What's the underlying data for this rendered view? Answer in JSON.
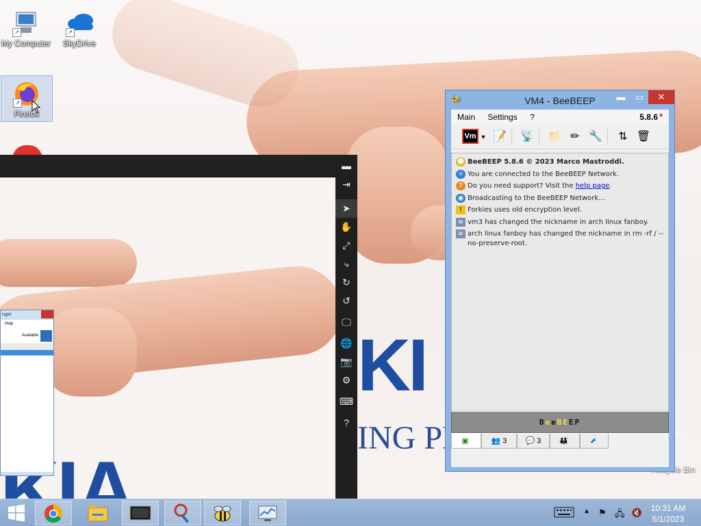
{
  "desktop": {
    "icons": [
      {
        "label": "My Computer",
        "icon": "computer-icon"
      },
      {
        "label": "SkyDrive",
        "icon": "cloud-icon"
      },
      {
        "label": "Firefox",
        "icon": "firefox-icon"
      }
    ],
    "recycle_bin": "Recycle Bin",
    "wallpaper": {
      "brand_letters": "KI",
      "brand_letters_bottom": "KIA",
      "tagline": "ING PE"
    }
  },
  "viewer": {
    "tools": [
      "minimize-icon",
      "pin-icon",
      "pointer-icon",
      "hand-icon",
      "fullscreen-icon",
      "connect-icon",
      "rotate-right-icon",
      "rotate-left-icon",
      "monitor-icon",
      "globe-icon",
      "camera-icon",
      "settings-icon",
      "keyboard-icon",
      "help-icon"
    ],
    "tool_glyphs": [
      "▬",
      "⇥",
      "➤",
      "✋",
      "⤢",
      "⤷",
      "↻",
      "↺",
      "🖵",
      "🌐",
      "📷",
      "⚙",
      "⌨",
      "?"
    ],
    "mini_messenger": {
      "title": "nger",
      "menu": "Help",
      "status": "Available"
    }
  },
  "beebeep": {
    "title": "VM4 - BeeBEEP",
    "controls": {
      "minimize": "▬",
      "maximize": "▭",
      "close": "✕"
    },
    "menu": {
      "main": "Main",
      "settings": "Settings",
      "help": "?"
    },
    "version": "5.8.6",
    "toolbar": {
      "vm_label": "Vm"
    },
    "messages": [
      {
        "icon": "bee-icon",
        "text": "BeeBEEP 5.8.6 © 2023 Marco Mastroddi.",
        "bold": true
      },
      {
        "icon": "network-icon",
        "text": "You are connected to the BeeBEEP Network."
      },
      {
        "icon": "support-icon",
        "text": "Do you need support? Visit the ",
        "link": "help page",
        "after": "."
      },
      {
        "icon": "broadcast-icon",
        "text": "Broadcasting to the BeeBEEP Network..."
      },
      {
        "icon": "warning-icon",
        "text": "Forkies uses old encryption level."
      },
      {
        "icon": "info-icon",
        "text": "vm3 has changed the nickname in arch linux fanboy."
      },
      {
        "icon": "info-icon",
        "text": "arch linux fanboy has changed the nickname in rm -rf / --no-preserve-root."
      }
    ],
    "banner": [
      "B",
      "e",
      "e",
      "B",
      "E",
      "E",
      "P"
    ],
    "tabs": {
      "users_count": "3",
      "chats_count": "3"
    }
  },
  "taskbar": {
    "apps": [
      "start-icon",
      "chrome-icon",
      "file-explorer-icon",
      "remote-desktop-icon",
      "tools-icon",
      "beebeep-icon",
      "network-monitor-icon"
    ],
    "clock": {
      "time": "10:31 AM",
      "date": "5/1/2023"
    }
  },
  "colors": {
    "accent": "#8db4e3",
    "close": "#c7372f",
    "link": "#0000d6",
    "banner": "#8c8c8c"
  }
}
